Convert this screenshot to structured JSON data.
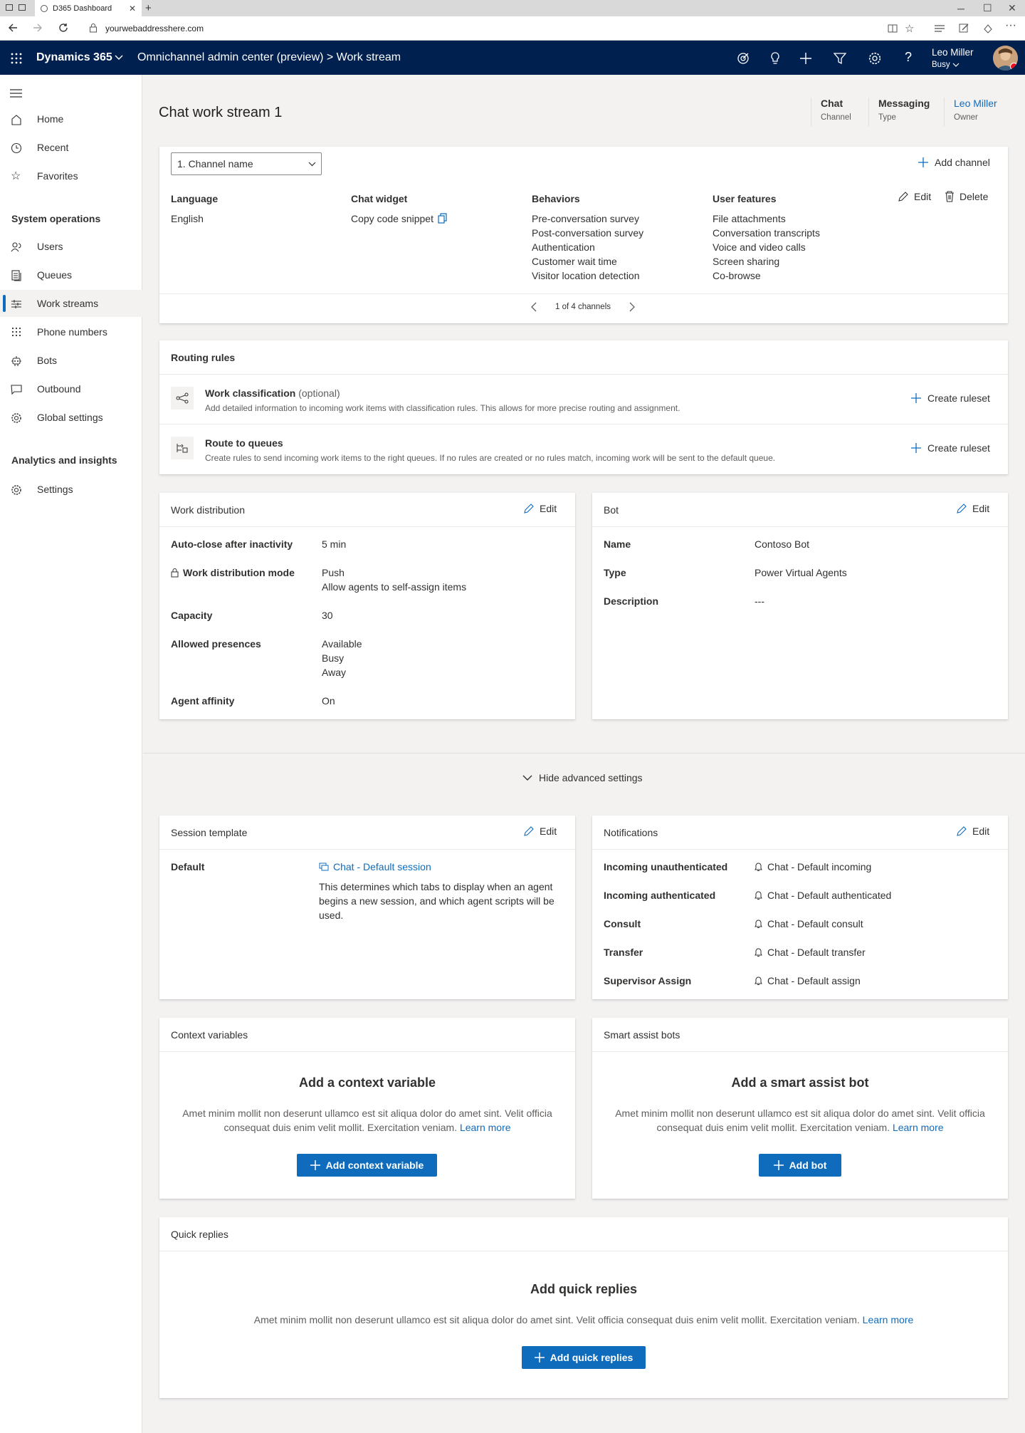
{
  "browser": {
    "tab_title": "D365 Dashboard",
    "url": "yourwebaddresshere.com"
  },
  "appbar": {
    "brand": "Dynamics 365",
    "breadcrumb": "Omnichannel admin center (preview) > Work stream",
    "user_name": "Leo Miller",
    "user_status": "Busy",
    "icons": [
      "target-icon",
      "lightbulb-icon",
      "plus-icon",
      "filter-icon",
      "gear-icon",
      "help-icon"
    ]
  },
  "sidebar": {
    "top_items": [
      {
        "label": "Home",
        "icon": "home-icon"
      },
      {
        "label": "Recent",
        "icon": "clock-icon"
      },
      {
        "label": "Favorites",
        "icon": "star-icon"
      }
    ],
    "section1": "System operations",
    "ops_items": [
      {
        "label": "Users",
        "icon": "users-icon"
      },
      {
        "label": "Queues",
        "icon": "queues-icon"
      },
      {
        "label": "Work streams",
        "icon": "work-streams-icon",
        "active": true
      },
      {
        "label": "Phone numbers",
        "icon": "dialpad-icon"
      },
      {
        "label": "Bots",
        "icon": "bot-icon"
      },
      {
        "label": "Outbound",
        "icon": "outbound-icon"
      },
      {
        "label": "Global settings",
        "icon": "gear-icon"
      }
    ],
    "section2": "Analytics and insights",
    "analytics_items": [
      {
        "label": "Settings",
        "icon": "gear-icon"
      }
    ]
  },
  "header": {
    "title": "Chat work stream 1",
    "fields": [
      {
        "value": "Chat",
        "key": "Channel"
      },
      {
        "value": "Messaging",
        "key": "Type"
      },
      {
        "value": "Leo Miller",
        "key": "Owner"
      }
    ]
  },
  "channel": {
    "selected": "1. Channel name",
    "add_channel": "Add channel",
    "edit": "Edit",
    "delete": "Delete",
    "language_label": "Language",
    "language": "English",
    "widget_label": "Chat widget",
    "widget_value": "Copy code snippet",
    "behaviors_label": "Behaviors",
    "behaviors": [
      "Pre-conversation survey",
      "Post-conversation survey",
      "Authentication",
      "Customer wait time",
      "Visitor location detection"
    ],
    "features_label": "User features",
    "features": [
      "File attachments",
      "Conversation transcripts",
      "Voice and video calls",
      "Screen sharing",
      "Co-browse"
    ],
    "pager": "1 of 4 channels"
  },
  "routing": {
    "title": "Routing rules",
    "rows": [
      {
        "title": "Work classification",
        "optional": "(optional)",
        "desc": "Add detailed information to incoming work items with classification rules. This allows for more precise routing and assignment.",
        "action": "Create ruleset"
      },
      {
        "title": "Route to queues",
        "optional": "",
        "desc": "Create rules to send incoming work items to the right queues. If no rules are created or no rules match, incoming work will be sent to the default queue.",
        "action": "Create ruleset"
      }
    ]
  },
  "work_distribution": {
    "title": "Work distribution",
    "edit": "Edit",
    "autoclose_label": "Auto-close after inactivity",
    "autoclose": "5 min",
    "mode_label": "Work distribution mode",
    "mode": "Push",
    "mode_sub": "Allow agents to self-assign items",
    "capacity_label": "Capacity",
    "capacity": "30",
    "presences_label": "Allowed presences",
    "presences": [
      "Available",
      "Busy",
      "Away"
    ],
    "affinity_label": "Agent affinity",
    "affinity": "On"
  },
  "bot": {
    "title": "Bot",
    "edit": "Edit",
    "name_label": "Name",
    "name": "Contoso Bot",
    "type_label": "Type",
    "type": "Power Virtual Agents",
    "desc_label": "Description",
    "desc": "---"
  },
  "advanced": {
    "toggle": "Hide advanced settings"
  },
  "session": {
    "title": "Session template",
    "edit": "Edit",
    "label": "Default",
    "value": "Chat - Default session",
    "desc": "This determines which tabs to display when an agent begins a new session, and which agent scripts will be used."
  },
  "notifications": {
    "title": "Notifications",
    "edit": "Edit",
    "rows": [
      {
        "label": "Incoming unauthenticated",
        "value": "Chat - Default incoming"
      },
      {
        "label": "Incoming authenticated",
        "value": "Chat - Default authenticated"
      },
      {
        "label": "Consult",
        "value": "Chat - Default consult"
      },
      {
        "label": "Transfer",
        "value": "Chat - Default transfer"
      },
      {
        "label": "Supervisor Assign",
        "value": "Chat - Default assign"
      }
    ]
  },
  "context_vars": {
    "title": "Context variables",
    "heading": "Add a context variable",
    "desc": "Amet minim mollit non deserunt ullamco est sit aliqua dolor do amet sint. Velit officia consequat duis enim velit mollit. Exercitation veniam.",
    "learn": "Learn more",
    "button": "Add context variable"
  },
  "smart_bots": {
    "title": "Smart assist bots",
    "heading": "Add a smart assist bot",
    "desc": "Amet minim mollit non deserunt ullamco est sit aliqua dolor do amet sint. Velit officia consequat duis enim velit mollit. Exercitation veniam.",
    "learn": "Learn more",
    "button": "Add bot"
  },
  "quick_replies": {
    "title": "Quick replies",
    "heading": "Add quick replies",
    "desc": "Amet minim mollit non deserunt ullamco est sit aliqua dolor do amet sint. Velit officia consequat duis enim velit mollit. Exercitation veniam.",
    "learn": "Learn more",
    "button": "Add quick replies"
  },
  "colors": {
    "appbar": "#002050",
    "accent": "#0f6cbd",
    "presence_busy": "#e81123"
  }
}
